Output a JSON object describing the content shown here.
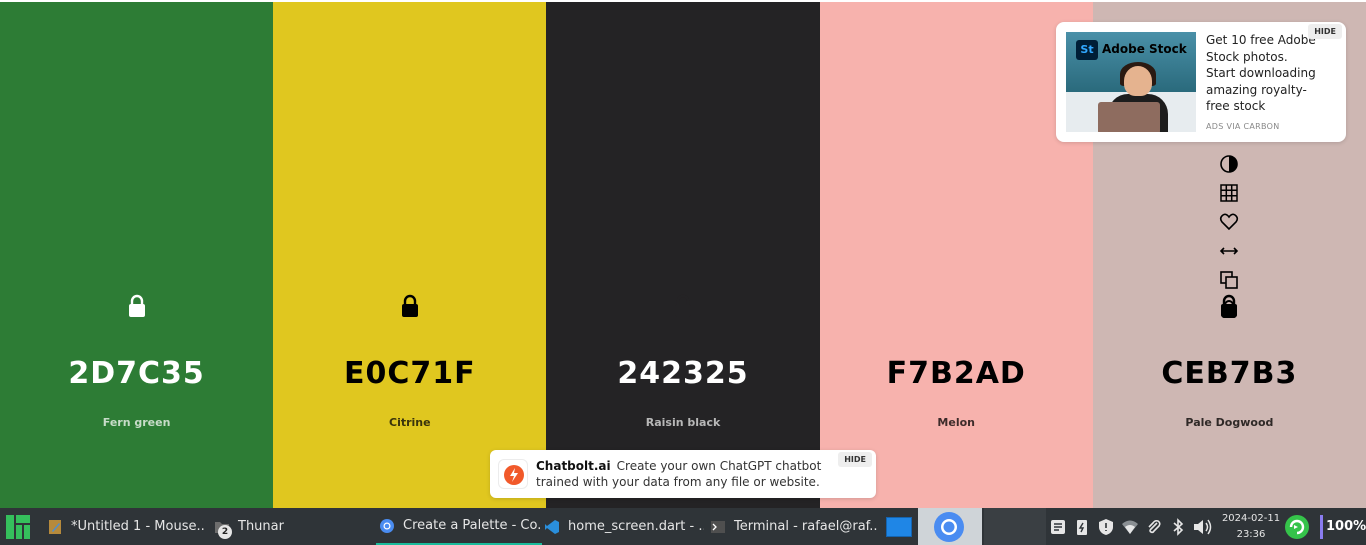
{
  "palette": [
    {
      "hex": "2D7C35",
      "name": "Fern green",
      "bg": "#2D7C35",
      "fg": "#ffffff",
      "sub": "#c8dcc9",
      "lock_color": "#ffffff"
    },
    {
      "hex": "E0C71F",
      "name": "Citrine",
      "bg": "#E0C71F",
      "fg": "#000000",
      "sub": "#3a340c",
      "lock_color": "#000000"
    },
    {
      "hex": "242325",
      "name": "Raisin black",
      "bg": "#242325",
      "fg": "#ffffff",
      "sub": "#b8b8b8",
      "lock_color": "#242325"
    },
    {
      "hex": "F7B2AD",
      "name": "Melon",
      "bg": "#F7B2AD",
      "fg": "#000000",
      "sub": "#3d2b2a",
      "lock_color": "#F7B2AD"
    },
    {
      "hex": "CEB7B3",
      "name": "Pale Dogwood",
      "bg": "#CEB7B3",
      "fg": "#000000",
      "sub": "#2f2927",
      "lock_color": "#000000"
    }
  ],
  "tools": [
    "contrast-icon",
    "grid-icon",
    "heart-icon",
    "drag-arrows-icon",
    "copy-icon",
    "unlock-icon"
  ],
  "ad_top": {
    "brand": "Adobe Stock",
    "brand_badge": "St",
    "text": "Get 10 free Adobe Stock photos. Start downloading amazing royalty-free stock",
    "via": "ADS VIA CARBON",
    "hide": "HIDE"
  },
  "ad_bottom": {
    "brand": "Chatbolt.ai",
    "text": "Create your own ChatGPT chatbot trained with your data from any file or website.",
    "hide": "HIDE"
  },
  "taskbar": {
    "items": [
      {
        "label": "*Untitled 1 - Mouse...",
        "icon": "mousepad-icon"
      },
      {
        "label": "Thunar",
        "icon": "folder-icon",
        "badge": "2"
      },
      {
        "label": "Create a Palette - Co...",
        "icon": "chromium-icon",
        "active": true
      },
      {
        "label": "home_screen.dart - ...",
        "icon": "vscode-icon"
      },
      {
        "label": "Terminal - rafael@raf...",
        "icon": "terminal-icon"
      }
    ],
    "date": "2024-02-11",
    "time": "23:36",
    "battery": "100%"
  }
}
